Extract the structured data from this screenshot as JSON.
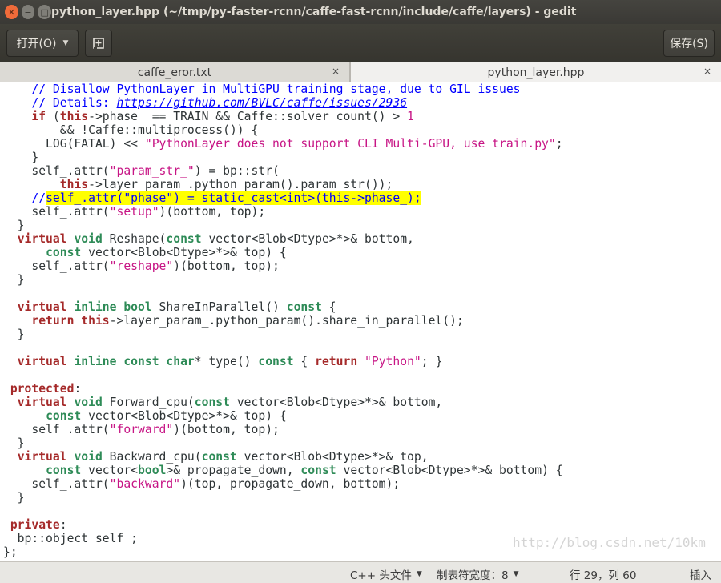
{
  "window": {
    "title": "python_layer.hpp (~/tmp/py-faster-rcnn/caffe-fast-rcnn/include/caffe/layers) - gedit",
    "close_glyph": "✕",
    "minimize_glyph": "−",
    "maximize_glyph": "□"
  },
  "toolbar": {
    "open_label": "打开(O)",
    "new_icon": "new-document-icon",
    "save_label": "保存(S)"
  },
  "tabs": [
    {
      "label": "caffe_eror.txt",
      "close": "×",
      "active": false
    },
    {
      "label": "python_layer.hpp",
      "close": "×",
      "active": true
    }
  ],
  "editor": {
    "lines": [
      "    // Disallow PythonLayer in MultiGPU training stage, due to GIL issues",
      "    // Details: https://github.com/BVLC/caffe/issues/2936",
      "    if (this->phase_ == TRAIN && Caffe::solver_count() > 1",
      "        && !Caffe::multiprocess()) {",
      "      LOG(FATAL) << \"PythonLayer does not support CLI Multi-GPU, use train.py\";",
      "    }",
      "    self_.attr(\"param_str_\") = bp::str(",
      "        this->layer_param_.python_param().param_str());",
      "    //self_.attr(\"phase\") = static_cast<int>(this->phase_);",
      "    self_.attr(\"setup\")(bottom, top);",
      "  }",
      "  virtual void Reshape(const vector<Blob<Dtype>*>& bottom,",
      "      const vector<Blob<Dtype>*>& top) {",
      "    self_.attr(\"reshape\")(bottom, top);",
      "  }",
      "",
      "  virtual inline bool ShareInParallel() const {",
      "    return this->layer_param_.python_param().share_in_parallel();",
      "  }",
      "",
      "  virtual inline const char* type() const { return \"Python\"; }",
      "",
      " protected:",
      "  virtual void Forward_cpu(const vector<Blob<Dtype>*>& bottom,",
      "      const vector<Blob<Dtype>*>& top) {",
      "    self_.attr(\"forward\")(bottom, top);",
      "  }",
      "  virtual void Backward_cpu(const vector<Blob<Dtype>*>& top,",
      "      const vector<bool>& propagate_down, const vector<Blob<Dtype>*>& bottom) {",
      "    self_.attr(\"backward\")(top, propagate_down, bottom);",
      "  }",
      "",
      " private:",
      "  bp::object self_;",
      "};"
    ],
    "highlighted_line": 8
  },
  "statusbar": {
    "language": "C++ 头文件",
    "tab_width": "制表符宽度：8",
    "position": "行 29，列 60",
    "mode": "插入",
    "watermark": "http://blog.csdn.net/10km"
  },
  "colors": {
    "keyword": "#a52a2a",
    "type": "#2e8b57",
    "string": "#c71585",
    "comment": "#0000ff",
    "highlight": "#ffff00"
  }
}
